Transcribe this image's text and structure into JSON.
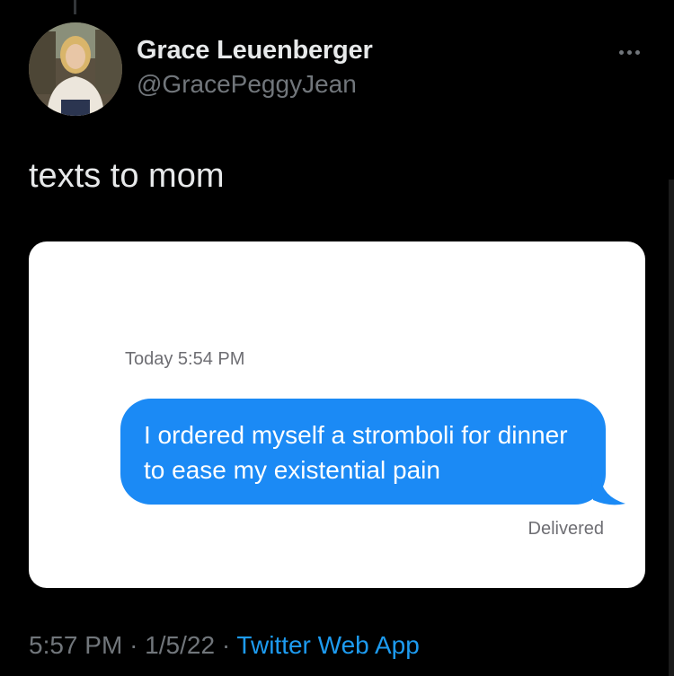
{
  "tweet": {
    "author_name": "Grace Leuenberger",
    "author_handle": "@GracePeggyJean",
    "text": "texts to mom",
    "time": "5:57 PM",
    "date": "1/5/22",
    "separator": "·",
    "source": "Twitter Web App"
  },
  "icons": {
    "more": "more-horizontal-icon",
    "avatar": "profile-photo"
  },
  "media": {
    "timestamp": "Today 5:54 PM",
    "message": "I ordered myself a stromboli for dinner to ease my existential pain",
    "status": "Delivered"
  },
  "colors": {
    "background": "#000000",
    "primary_text": "#e7e9ea",
    "secondary_text": "#71767b",
    "link": "#1d9bf0",
    "imessage_blue": "#1b8af5"
  }
}
